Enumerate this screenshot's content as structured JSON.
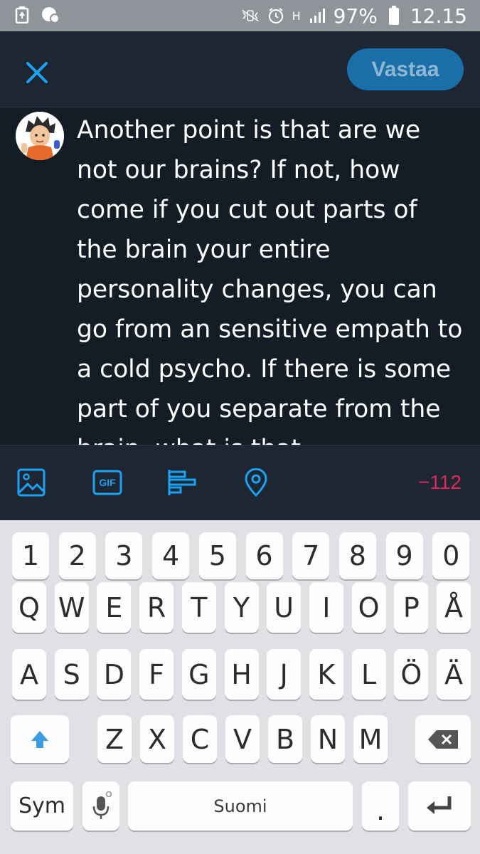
{
  "status_bar": {
    "battery": "97%",
    "time": "12.15",
    "network": "H"
  },
  "header": {
    "reply_button": "Vastaa"
  },
  "composer": {
    "text": "Another point is that are we not our brains? If not, how come if you cut out parts of the brain your entire personality changes, you can go from an sensitive empath to a cold psycho. If there is some part of you separate from the brain, what is that"
  },
  "toolbar": {
    "gif_label": "GIF",
    "char_counter": "−112"
  },
  "keyboard": {
    "row_numbers": [
      "1",
      "2",
      "3",
      "4",
      "5",
      "6",
      "7",
      "8",
      "9",
      "0"
    ],
    "row1": [
      "Q",
      "W",
      "E",
      "R",
      "T",
      "Y",
      "U",
      "I",
      "O",
      "P",
      "Å"
    ],
    "row2": [
      "A",
      "S",
      "D",
      "F",
      "G",
      "H",
      "J",
      "K",
      "L",
      "Ö",
      "Ä"
    ],
    "row3": [
      "Z",
      "X",
      "C",
      "V",
      "B",
      "N",
      "M"
    ],
    "sym_label": "Sym",
    "space_label": "Suomi",
    "period_label": "."
  },
  "colors": {
    "accent": "#1da1f2",
    "background": "#141d26",
    "bar": "#1c2733",
    "counter_negative": "#e0245e"
  }
}
